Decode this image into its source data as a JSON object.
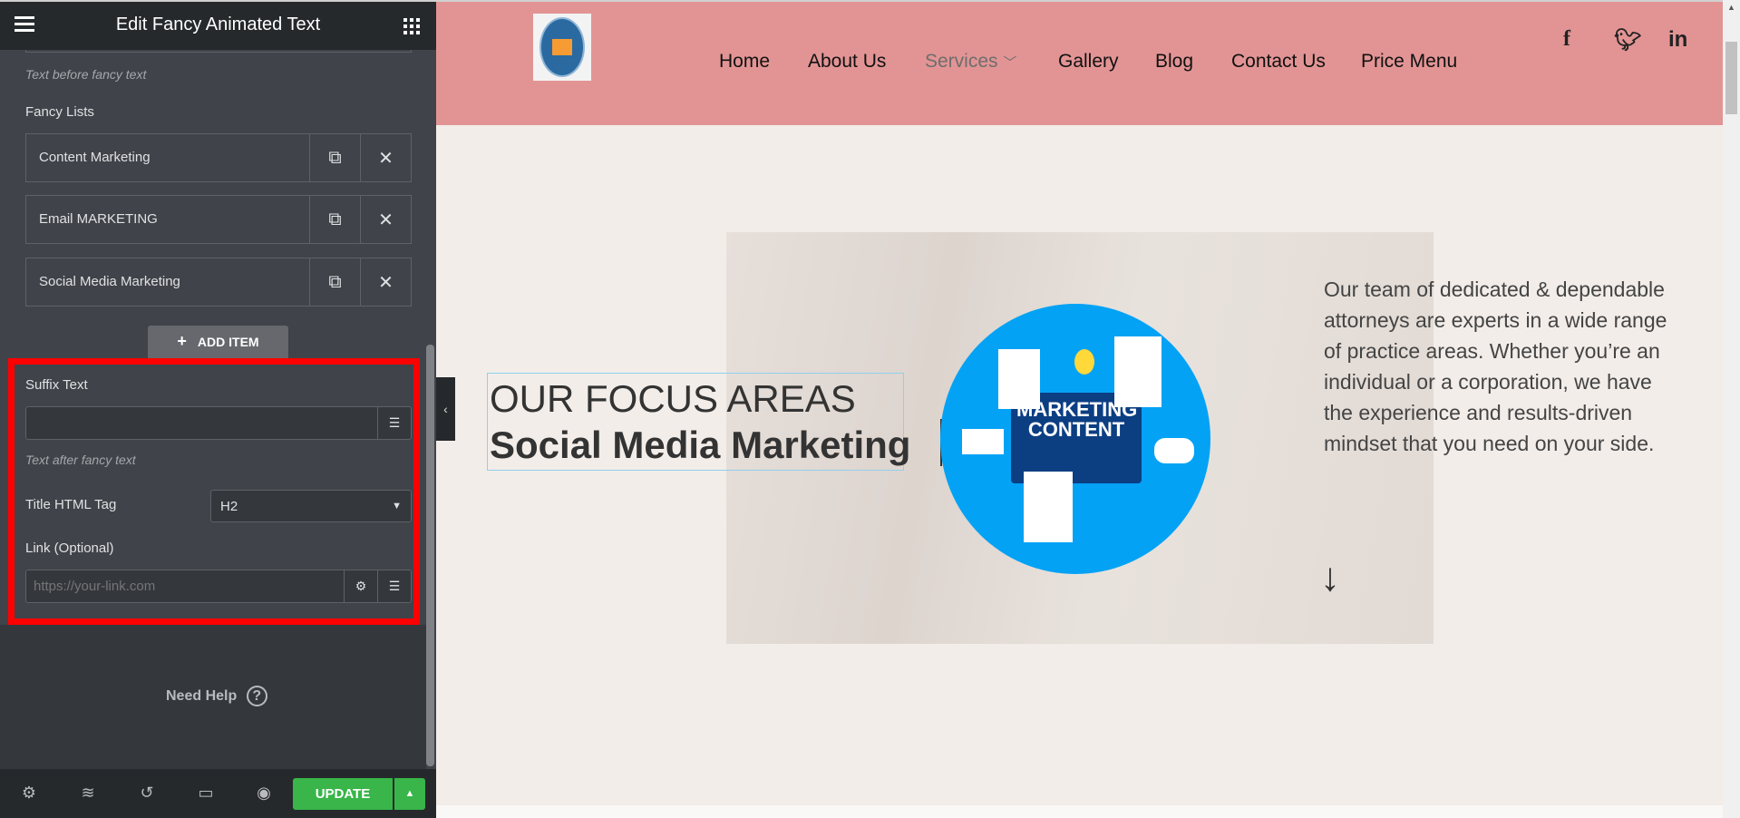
{
  "panel": {
    "title": "Edit Fancy Animated Text",
    "prefix_hint": "Text before fancy text",
    "fancy_lists_label": "Fancy Lists",
    "items": [
      {
        "label": "Content Marketing"
      },
      {
        "label": "Email MARKETING"
      },
      {
        "label": "Social Media Marketing"
      }
    ],
    "add_item": "ADD ITEM",
    "suffix_label": "Suffix Text",
    "suffix_value": "",
    "suffix_hint": "Text after fancy text",
    "tag_label": "Title HTML Tag",
    "tag_value": "H2",
    "link_label": "Link (Optional)",
    "link_placeholder": "https://your-link.com",
    "need_help": "Need Help",
    "update": "UPDATE",
    "highlight_color": "#ff0000",
    "update_color": "#39b54a"
  },
  "site": {
    "nav": [
      "Home",
      "About Us",
      "Services",
      "Gallery",
      "Blog",
      "Contact Us",
      "Price Menu"
    ],
    "heading_line1": "OUR FOCUS AREAS",
    "heading_line2": "Social Media Marketing",
    "image_text": [
      "MARKETING",
      "CONTENT"
    ],
    "paragraph": "Our team of dedicated & dependable attorneys are experts in a wide range of practice areas. Whether you’re an individual or a corporation, we have the experience and results-driven mindset that you need on your side.",
    "header_color": "#e29494"
  }
}
